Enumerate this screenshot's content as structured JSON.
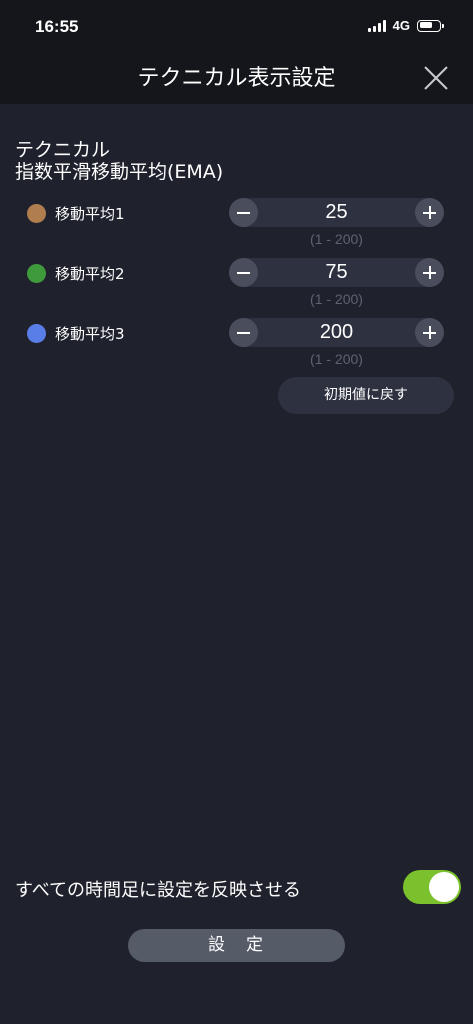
{
  "status_bar": {
    "time": "16:55",
    "network": "4G"
  },
  "header": {
    "title": "テクニカル表示設定"
  },
  "section": {
    "title": "テクニカル",
    "subtitle": "指数平滑移動平均(EMA)"
  },
  "moving_averages": [
    {
      "label": "移動平均1",
      "value": "25",
      "range": "(1 - 200)",
      "color": "#b07d4e"
    },
    {
      "label": "移動平均2",
      "value": "75",
      "range": "(1 - 200)",
      "color": "#3f9a3b"
    },
    {
      "label": "移動平均3",
      "value": "200",
      "range": "(1 - 200)",
      "color": "#5a7ee8"
    }
  ],
  "reset_label": "初期値に戻す",
  "apply_all": {
    "label": "すべての時間足に設定を反映させる",
    "enabled": true,
    "color": "#7ac12d"
  },
  "submit_label": "設　定"
}
